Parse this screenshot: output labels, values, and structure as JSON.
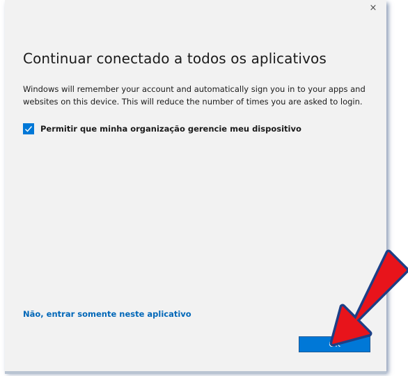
{
  "dialog": {
    "close_glyph": "×",
    "title": "Continuar conectado a todos os aplicativos",
    "description": "Windows will remember your account and automatically sign you in to your apps and websites on this device. This will reduce the number of times you are asked to login.",
    "checkbox": {
      "label": "Permitir que minha organização gerencie meu dispositivo",
      "checked": true
    },
    "secondary_link": "Não, entrar somente neste aplicativo",
    "ok_label": "OK"
  },
  "annotation": {
    "icon": "red-arrow-icon",
    "color": "#e8141b",
    "outline_color": "#1d3f86"
  },
  "colors": {
    "accent": "#0078d7",
    "link": "#0067b8",
    "dialog_bg": "#f2f2f2"
  }
}
